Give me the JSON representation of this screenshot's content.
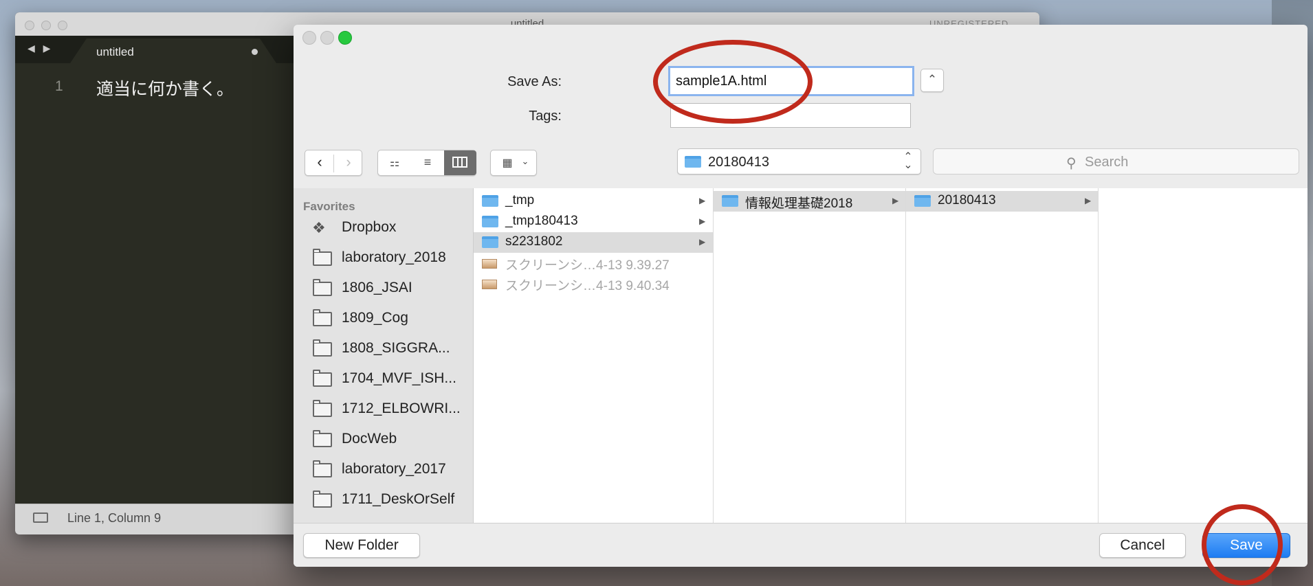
{
  "editor": {
    "window_title": "untitled",
    "unregistered_label": "UNREGISTERED",
    "tab_label": "untitled",
    "line_number": "1",
    "code_text": "適当に何か書く。",
    "status_text": "Line 1, Column 9"
  },
  "dialog": {
    "save_as_label": "Save As:",
    "filename_value": "sample1A.html",
    "tags_label": "Tags:",
    "tags_value": "",
    "location_popup": "20180413",
    "search_placeholder": "Search",
    "favorites_header": "Favorites",
    "favorites": [
      {
        "label": "Dropbox",
        "icon": "dropbox-icon"
      },
      {
        "label": "laboratory_2018",
        "icon": "folder-icon"
      },
      {
        "label": "1806_JSAI",
        "icon": "folder-icon"
      },
      {
        "label": "1809_Cog",
        "icon": "folder-icon"
      },
      {
        "label": "1808_SIGGRA...",
        "icon": "folder-icon"
      },
      {
        "label": "1704_MVF_ISH...",
        "icon": "folder-icon"
      },
      {
        "label": "1712_ELBOWRI...",
        "icon": "folder-icon"
      },
      {
        "label": "DocWeb",
        "icon": "folder-icon"
      },
      {
        "label": "laboratory_2017",
        "icon": "folder-icon"
      },
      {
        "label": "1711_DeskOrSelf",
        "icon": "folder-icon"
      }
    ],
    "column1": [
      {
        "label": "_tmp",
        "type": "folder",
        "arrow": "▶"
      },
      {
        "label": "_tmp180413",
        "type": "folder",
        "arrow": "▶"
      },
      {
        "label": "s2231802",
        "type": "folder",
        "arrow": "▶",
        "selected": true
      },
      {
        "label": "スクリーンシ…4-13 9.39.27",
        "type": "image"
      },
      {
        "label": "スクリーンシ…4-13 9.40.34",
        "type": "image"
      }
    ],
    "column2": [
      {
        "label": "情報処理基礎2018",
        "type": "folder",
        "arrow": "▶",
        "selected": true
      }
    ],
    "column3": [
      {
        "label": "20180413",
        "type": "folder",
        "arrow": "▶",
        "selected": true
      }
    ],
    "new_folder_label": "New Folder",
    "cancel_label": "Cancel",
    "save_label": "Save"
  },
  "colors": {
    "accent": "#1d7cf2",
    "annotation_ring": "#c02a1c",
    "folder": "#6fb7ef"
  }
}
